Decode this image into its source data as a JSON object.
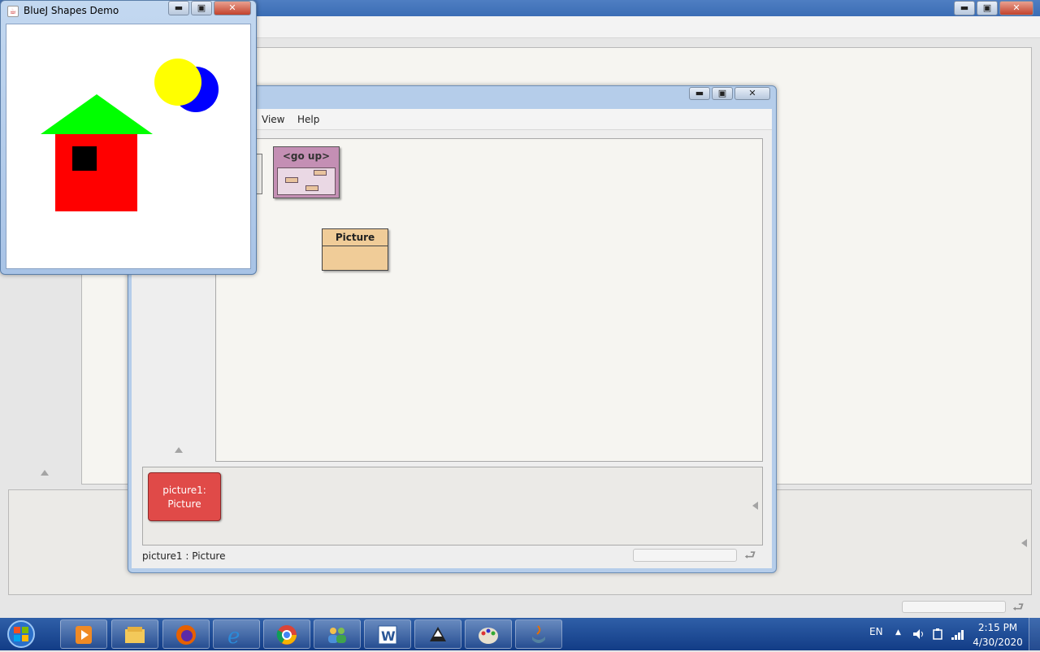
{
  "background_window": {
    "title_bar_controls": {
      "minimize": "▬",
      "maximize": "▣",
      "close": "✕"
    }
  },
  "project_window": {
    "controls": {
      "minimize": "▬",
      "maximize": "▣",
      "close": "✕"
    },
    "menu": {
      "view": "View",
      "help": "Help"
    },
    "go_up_label": "<go up>",
    "class_name": "Picture",
    "object": {
      "line1": "picture1:",
      "line2": "Picture"
    },
    "status_text": "picture1 : Picture"
  },
  "shapes_window": {
    "title": "BlueJ Shapes Demo",
    "controls": {
      "minimize": "▬",
      "maximize": "▣",
      "close": "✕"
    },
    "shapes": {
      "wall_color": "#ff0000",
      "roof_color": "#00ff00",
      "window_color": "#000000",
      "sun_color": "#ffff00",
      "moon_color": "#0000ff"
    }
  },
  "taskbar": {
    "apps": [
      "media-player-icon",
      "file-explorer-icon",
      "firefox-icon",
      "internet-explorer-icon",
      "chrome-icon",
      "people-icon",
      "word-icon",
      "inkscape-icon",
      "paint-icon",
      "java-icon"
    ],
    "language": "EN",
    "time": "2:15 PM",
    "date": "4/30/2020"
  }
}
